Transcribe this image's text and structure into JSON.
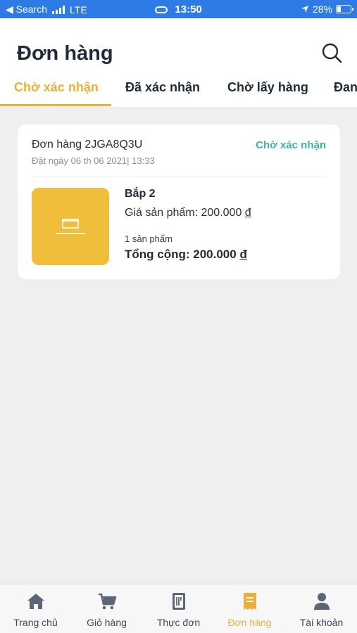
{
  "status_bar": {
    "back_label": "◀ Search",
    "network": "LTE",
    "time": "13:50",
    "battery": "28%"
  },
  "header": {
    "title": "Đơn hàng",
    "tabs": [
      {
        "label": "Chờ xác nhận",
        "active": true
      },
      {
        "label": "Đã xác nhận",
        "active": false
      },
      {
        "label": "Chờ lấy hàng",
        "active": false
      },
      {
        "label": "Đan",
        "active": false
      }
    ]
  },
  "order": {
    "id_label": "Đơn hàng 2JGA8Q3U",
    "date_label": "Đặt ngày 06 th 06 2021| 13:33",
    "status": "Chờ xác nhận",
    "status_color": "#40b39a",
    "product_name": "Bắp 2",
    "price_prefix": "Giá sản phẩm: 200.000 ",
    "currency": "đ",
    "quantity_label": "1 sản phẩm",
    "total_prefix": "Tổng cộng: 200.000 ",
    "thumbnail_color": "#f1be3c"
  },
  "bottom_nav": [
    {
      "label": "Trang chủ",
      "icon": "home-icon",
      "active": false
    },
    {
      "label": "Giỏ hàng",
      "icon": "cart-icon",
      "active": false
    },
    {
      "label": "Thực đơn",
      "icon": "menu-book-icon",
      "active": false
    },
    {
      "label": "Đơn hàng",
      "icon": "receipt-icon",
      "active": true
    },
    {
      "label": "Tài khoản",
      "icon": "user-icon",
      "active": false
    }
  ],
  "colors": {
    "accent": "#e9b13a",
    "status_bar": "#2f7be6",
    "background": "#efefef"
  }
}
